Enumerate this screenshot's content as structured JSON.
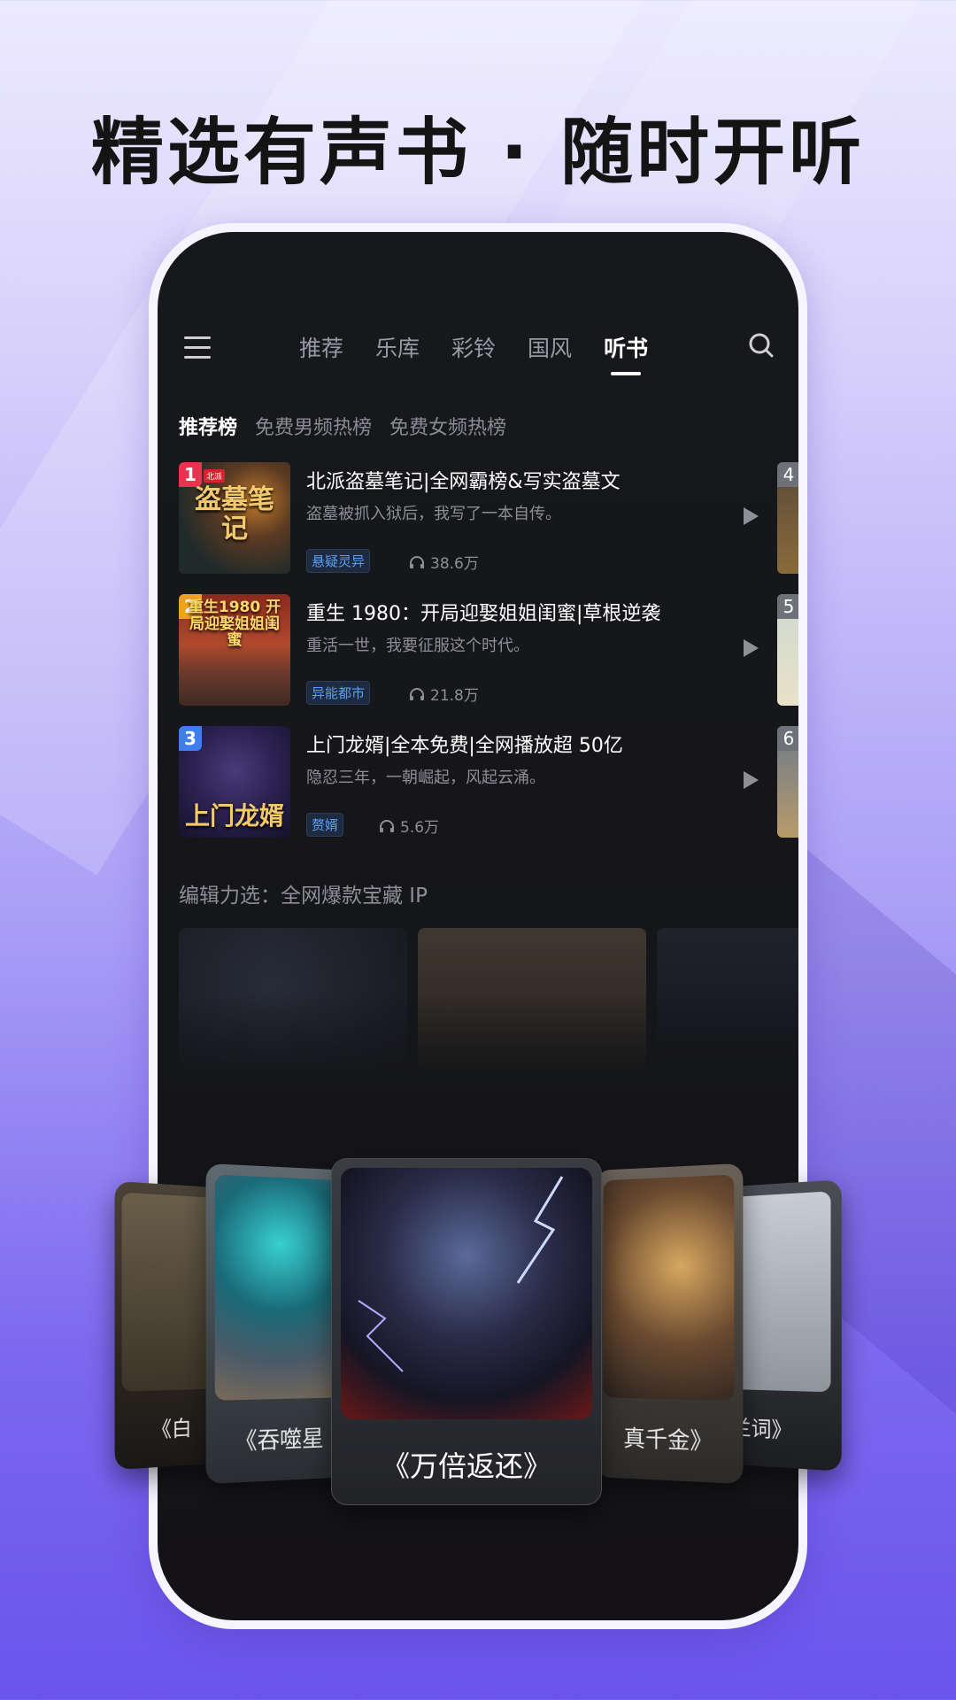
{
  "headline": "精选有声书 · 随时开听",
  "nav": {
    "tabs": [
      "推荐",
      "乐库",
      "彩铃",
      "国风",
      "听书"
    ],
    "active_index": 4
  },
  "chart_tabs": [
    "推荐榜",
    "免费男频热榜",
    "免费女频热榜"
  ],
  "chart": [
    {
      "rank": "1",
      "rank_color": "#e8344f",
      "cover_text": "盗墓笔记",
      "cover_badge": "北派",
      "title": "北派盗墓笔记|全网霸榜&写实盗墓文",
      "desc": "盗墓被抓入狱后，我写了一本自传。",
      "tag": "悬疑灵异",
      "plays": "38.6万"
    },
    {
      "rank": "2",
      "rank_color": "#f0a020",
      "cover_text": "重生1980 开局迎娶姐姐闺蜜",
      "title": "重生 1980：开局迎娶姐姐闺蜜|草根逆袭",
      "desc": "重活一世，我要征服这个时代。",
      "tag": "异能都市",
      "plays": "21.8万"
    },
    {
      "rank": "3",
      "rank_color": "#3f7df0",
      "cover_text": "上门龙婿",
      "title": "上门龙婿|全本免费|全网播放超 50亿",
      "desc": "隐忍三年，一朝崛起，风起云涌。",
      "tag": "赘婿",
      "plays": "5.6万"
    }
  ],
  "side_ranks": [
    "4",
    "5",
    "6"
  ],
  "editor_title": "编辑力选：全网爆款宝藏 IP",
  "carousel": {
    "center": "《万倍返还》",
    "left1": "《吞噬星",
    "left2": "《白",
    "right1": "真千金》",
    "right2": "兰词》"
  }
}
